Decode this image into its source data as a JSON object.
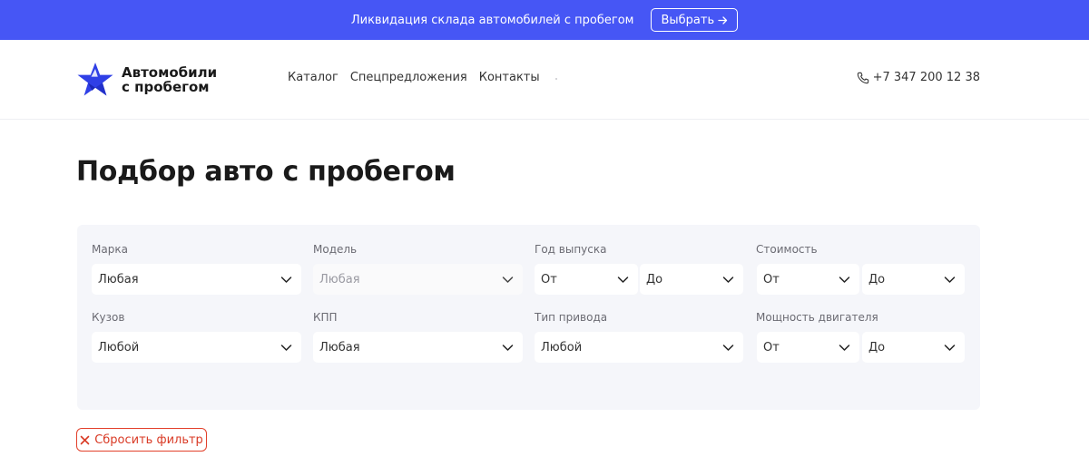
{
  "promo": {
    "text": "Ликвидация склада автомобилей с пробегом",
    "button_label": "Выбрать",
    "button_icon": "arrow-right-icon"
  },
  "header": {
    "logo_line1": "Автомобили",
    "logo_line2": "с пробегом",
    "nav": [
      "Каталог",
      "Спецпредложения",
      "Контакты"
    ],
    "phone": "+7 347 200 12 38"
  },
  "page": {
    "title": "Подбор авто с пробегом"
  },
  "filters": {
    "brand": {
      "label": "Марка",
      "value": "Любая"
    },
    "model": {
      "label": "Модель",
      "value": "Любая",
      "disabled": true
    },
    "year": {
      "label": "Год выпуска",
      "from": "От",
      "to": "До"
    },
    "price": {
      "label": "Стоимость",
      "from": "От",
      "to": "До"
    },
    "body": {
      "label": "Кузов",
      "value": "Любой"
    },
    "gearbox": {
      "label": "КПП",
      "value": "Любая"
    },
    "drive": {
      "label": "Тип привода",
      "value": "Любой"
    },
    "power": {
      "label": "Мощность двигателя",
      "from": "От",
      "to": "До"
    }
  },
  "reset": {
    "label": "Сбросить фильтр"
  },
  "colors": {
    "promo_bg": "#4656f5",
    "accent_blue": "#2f3fe6",
    "reset_red": "#e2402b",
    "panel_bg": "#f5f6fa"
  }
}
